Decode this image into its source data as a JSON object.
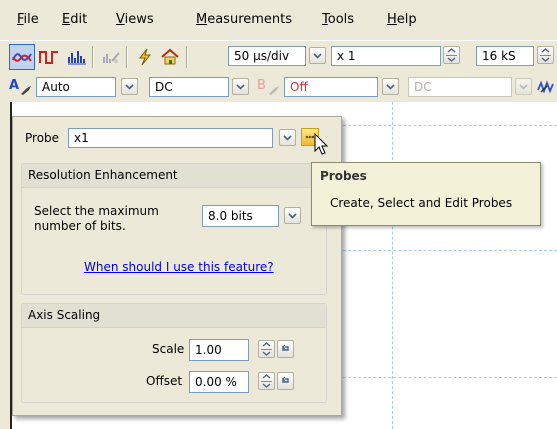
{
  "menu": {
    "file": {
      "mnemonic": "F",
      "rest": "ile"
    },
    "edit": {
      "mnemonic": "E",
      "rest": "dit"
    },
    "views": {
      "mnemonic": "V",
      "rest": "iews"
    },
    "measurements": {
      "mnemonic": "M",
      "rest": "easurements"
    },
    "tools": {
      "mnemonic": "T",
      "rest": "ools"
    },
    "help": {
      "mnemonic": "H",
      "rest": "elp"
    }
  },
  "toolbar1": {
    "timebase_value": "50 µs/div",
    "zoom_value": "x 1",
    "samples_value": "16 kS"
  },
  "toolbar2": {
    "channel_a_label": "A",
    "channel_a_range": "Auto",
    "channel_a_coupling": "DC",
    "channel_b_label": "B",
    "channel_b_range": "Off",
    "channel_b_coupling": "DC"
  },
  "panel": {
    "probe_label": "Probe",
    "probe_value": "x1",
    "resolution_section": {
      "title": "Resolution Enhancement",
      "description_line1": "Select the maximum",
      "description_line2": "number of bits.",
      "bits_value": "8.0 bits",
      "help_link": "When should I use this feature?"
    },
    "axis_section": {
      "title": "Axis Scaling",
      "scale_label": "Scale",
      "scale_value": "1.00",
      "offset_label": "Offset",
      "offset_value": "0.00 %"
    }
  },
  "tooltip": {
    "title": "Probes",
    "body": "Create, Select and Edit Probes"
  },
  "colors": {
    "channel_a": "#1f48c8",
    "channel_b": "#d03030",
    "link": "#0000ee",
    "grid": "#a8cde8"
  },
  "icons": [
    "scope-view-icon",
    "persistence-icon",
    "spectrum-icon",
    "spectrum-disabled-icon",
    "trigger-icon",
    "home-icon",
    "probe-manager-icon",
    "cursor-arrow-icon"
  ]
}
